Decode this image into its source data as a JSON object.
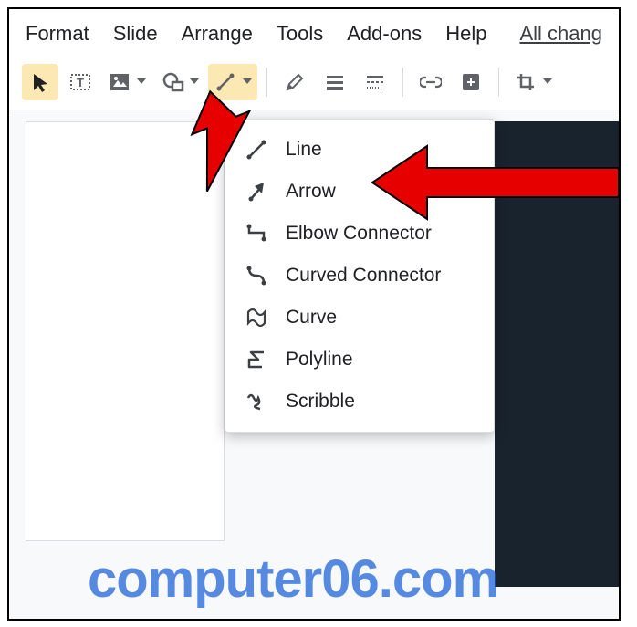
{
  "menubar": {
    "items": [
      "Format",
      "Slide",
      "Arrange",
      "Tools",
      "Add-ons",
      "Help"
    ],
    "status_link": "All chang"
  },
  "toolbar": {
    "select": "select-tool",
    "textbox": "textbox-tool",
    "image": "image-tool",
    "shape": "shape-tool",
    "line": "line-tool",
    "pen": "pen-tool",
    "align": "align-tool",
    "list": "list-tool",
    "link": "link-tool",
    "comment": "comment-tool",
    "crop": "crop-tool"
  },
  "line_menu": {
    "items": [
      {
        "label": "Line",
        "icon": "line-icon"
      },
      {
        "label": "Arrow",
        "icon": "arrow-icon"
      },
      {
        "label": "Elbow Connector",
        "icon": "elbow-icon"
      },
      {
        "label": "Curved Connector",
        "icon": "curved-icon"
      },
      {
        "label": "Curve",
        "icon": "curve-icon"
      },
      {
        "label": "Polyline",
        "icon": "polyline-icon"
      },
      {
        "label": "Scribble",
        "icon": "scribble-icon"
      }
    ]
  },
  "watermark": "computer06.com"
}
